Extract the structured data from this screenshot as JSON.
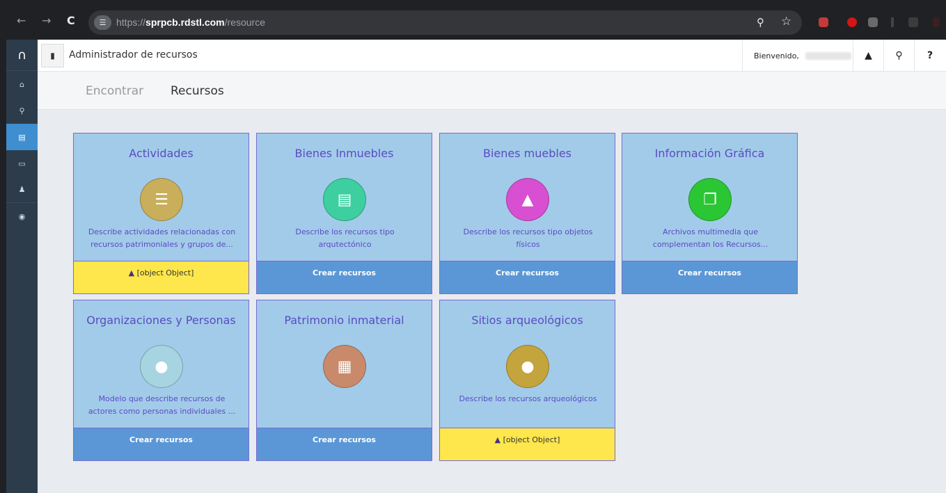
{
  "browser": {
    "url_prefix": "https://",
    "url_domain": "sprpcb.rdstl.com",
    "url_path": "/resource"
  },
  "header": {
    "title": "Administrador de recursos",
    "welcome": "Bienvenido,",
    "help_label": "?"
  },
  "tabs": {
    "find": "Encontrar",
    "resources": "Recursos"
  },
  "cards": [
    {
      "title": "Actividades",
      "desc1": "Describe actividades relacionadas con",
      "desc2": "recursos patrimoniales y grupos de...",
      "footer": "[object Object]",
      "footer_type": "warning",
      "icon": "list-icon",
      "icon_color": "#c9ae5b"
    },
    {
      "title": "Bienes Inmuebles",
      "desc1": "Describe los recursos tipo",
      "desc2": "arqutectónico",
      "footer": "Crear recursos",
      "footer_type": "create",
      "icon": "bank-icon",
      "icon_color": "#3dcfa0"
    },
    {
      "title": "Bienes muebles",
      "desc1": "Describe los recursos tipo objetos",
      "desc2": "físicos",
      "footer": "Crear recursos",
      "footer_type": "create",
      "icon": "bell-icon",
      "icon_color": "#d84fd2"
    },
    {
      "title": "Información Gráfica",
      "desc1": "Archivos multimedia que",
      "desc2": "complementan los Recursos...",
      "footer": "Crear recursos",
      "footer_type": "create",
      "icon": "copy-icon",
      "icon_color": "#2bc634"
    },
    {
      "title": "Organizaciones y Personas",
      "desc1": "Modelo que describe recursos de",
      "desc2": "actores como personas individuales ...",
      "footer": "Crear recursos",
      "footer_type": "create",
      "icon": "android-icon",
      "icon_color": "#a6d4e0"
    },
    {
      "title": "Patrimonio inmaterial",
      "desc1": "",
      "desc2": "",
      "footer": "Crear recursos",
      "footer_type": "create",
      "icon": "document-icon",
      "icon_color": "#c98a6b"
    },
    {
      "title": "Sitios arqueológicos",
      "desc1": "",
      "desc2": "Describe los recursos arqueológicos",
      "footer": "[object Object]",
      "footer_type": "warning",
      "icon": "map-marker-icon",
      "icon_color": "#c4a43c"
    }
  ]
}
